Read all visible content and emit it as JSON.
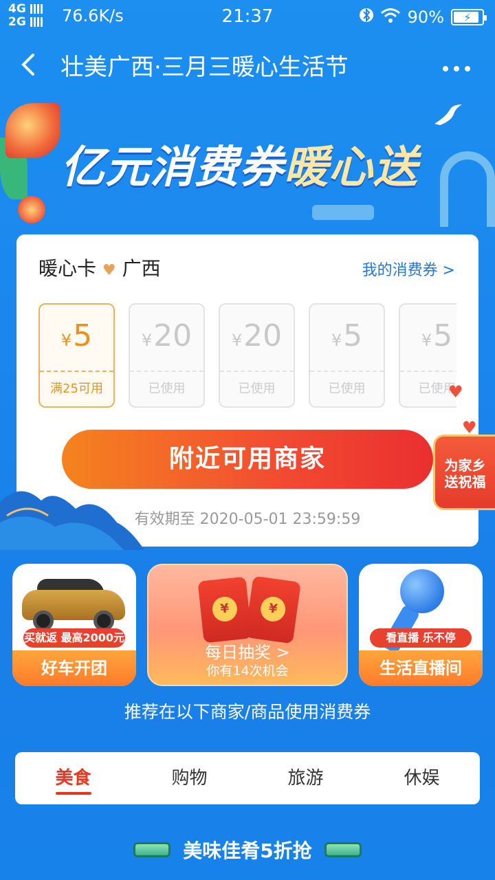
{
  "status": {
    "signal1": "4G",
    "signal2": "2G",
    "net_speed": "76.6K/s",
    "time": "21:37",
    "battery": "90%",
    "battery_level": 0.9
  },
  "nav": {
    "title": "壮美广西·三月三暖心生活节"
  },
  "banner": {
    "headline_part1": "亿元消费券",
    "headline_part2": "暖心送"
  },
  "card": {
    "title_left": "暖心卡",
    "title_right": "广西",
    "my_coupons": "我的消费券 >",
    "currency": "¥",
    "coupons": [
      {
        "amount": "5",
        "status": "满25可用"
      },
      {
        "amount": "20",
        "status": "已使用"
      },
      {
        "amount": "20",
        "status": "已使用"
      },
      {
        "amount": "5",
        "status": "已使用"
      },
      {
        "amount": "5",
        "status": "已使用"
      }
    ],
    "cta": "附近可用商家",
    "validity": "有效期至 2020-05-01 23:59:59",
    "badge_line1": "为家乡",
    "badge_line2": "送祝福"
  },
  "tiles": {
    "car_tag": "买就返 最高2000元",
    "car_label": "好车开团",
    "lottery_line1": "每日抽奖 >",
    "lottery_line2": "你有14次机会",
    "live_tag": "看直播 乐不停",
    "live_label": "生活直播间"
  },
  "recommend": "推荐在以下商家/商品使用消费券",
  "tabs": [
    "美食",
    "购物",
    "旅游",
    "休娱"
  ],
  "section_title": "美味佳肴5折抢",
  "colors": {
    "accent_red": "#e8361f",
    "brand_blue": "#1a86ec",
    "coupon_orange": "#e9921e"
  }
}
